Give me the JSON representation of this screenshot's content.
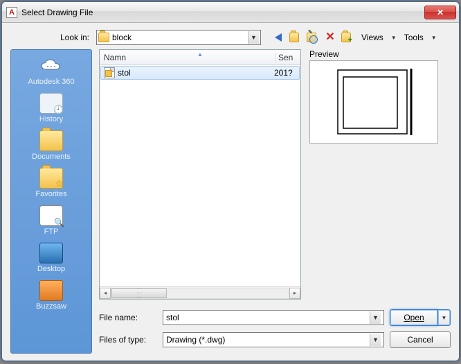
{
  "title": "Select Drawing File",
  "lookin_label": "Look in:",
  "lookin_value": "block",
  "toolbar": {
    "views": "Views",
    "tools": "Tools"
  },
  "sidebar": {
    "items": [
      {
        "label": "Autodesk 360",
        "icon": "cloud"
      },
      {
        "label": "History",
        "icon": "history"
      },
      {
        "label": "Documents",
        "icon": "folder"
      },
      {
        "label": "Favorites",
        "icon": "folder-star"
      },
      {
        "label": "FTP",
        "icon": "ftp"
      },
      {
        "label": "Desktop",
        "icon": "desktop"
      },
      {
        "label": "Buzzsaw",
        "icon": "buzzsaw"
      }
    ]
  },
  "filelist": {
    "col_name": "Namn",
    "col_date": "Sen",
    "rows": [
      {
        "name": "stol",
        "date": "201?"
      }
    ]
  },
  "preview_label": "Preview",
  "filename_label": "File name:",
  "filename_value": "stol",
  "filetype_label": "Files of type:",
  "filetype_value": "Drawing (*.dwg)",
  "open_label": "Open",
  "cancel_label": "Cancel"
}
